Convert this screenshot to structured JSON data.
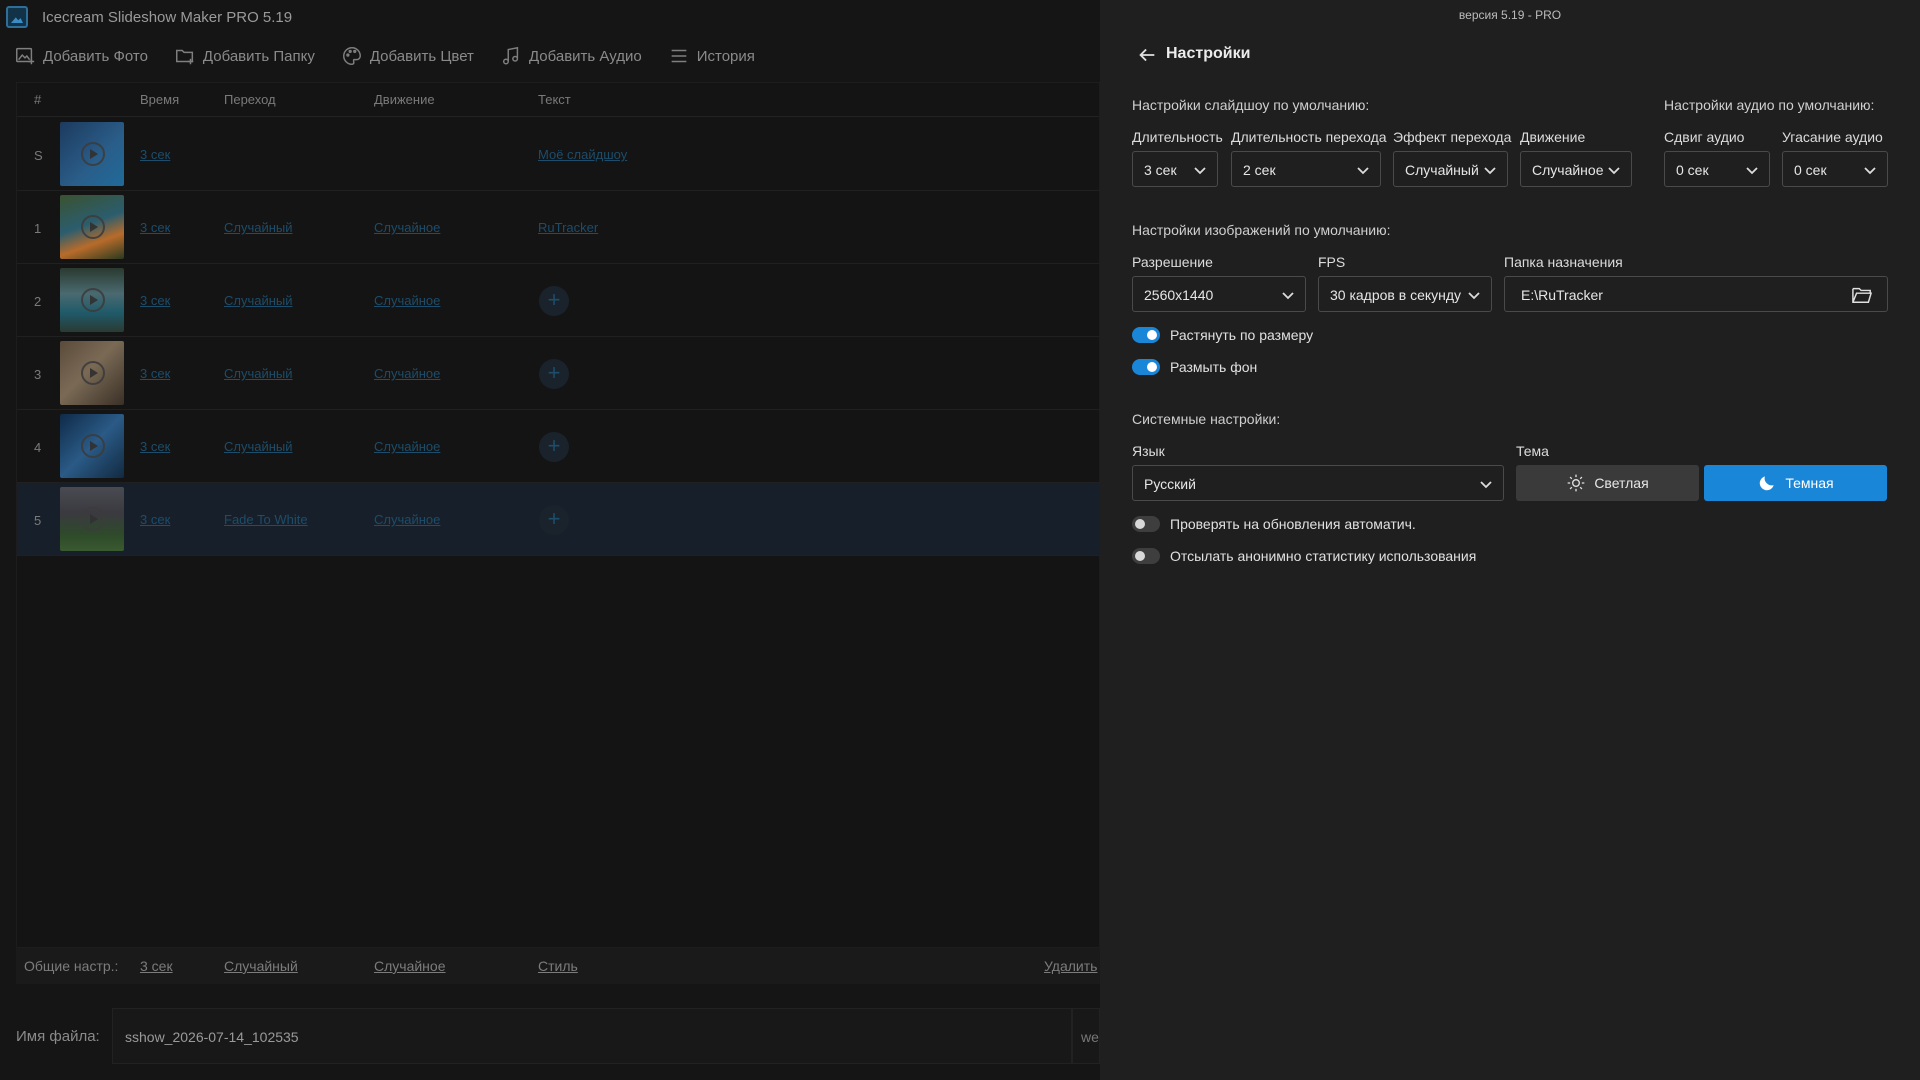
{
  "app": {
    "title": "Icecream Slideshow Maker PRO 5.19"
  },
  "toolbar": {
    "add_photo": "Добавить Фото",
    "add_folder": "Добавить Папку",
    "add_color": "Добавить Цвет",
    "add_audio": "Добавить Аудио",
    "history": "История"
  },
  "table": {
    "headers": {
      "num": "#",
      "time": "Время",
      "transition": "Переход",
      "motion": "Движение",
      "text": "Текст"
    },
    "rows": [
      {
        "num": "S",
        "time": "3 сек",
        "transition": "",
        "motion": "",
        "text": "Моё слайдшоу"
      },
      {
        "num": "1",
        "time": "3 сек",
        "transition": "Случайный",
        "motion": "Случайное",
        "text": "RuTracker"
      },
      {
        "num": "2",
        "time": "3 сек",
        "transition": "Случайный",
        "motion": "Случайное",
        "text": ""
      },
      {
        "num": "3",
        "time": "3 сек",
        "transition": "Случайный",
        "motion": "Случайное",
        "text": ""
      },
      {
        "num": "4",
        "time": "3 сек",
        "transition": "Случайный",
        "motion": "Случайное",
        "text": ""
      },
      {
        "num": "5",
        "time": "3 сек",
        "transition": "Fade To White",
        "motion": "Случайное",
        "text": ""
      }
    ],
    "add_text_icon": "+"
  },
  "footer": {
    "general_label": "Общие настр.:",
    "time": "3 сек",
    "transition": "Случайный",
    "motion": "Случайное",
    "style": "Стиль",
    "delete": "Удалить"
  },
  "filename": {
    "label": "Имя файла:",
    "value": "sshow_2026-07-14_102535",
    "ext": "we"
  },
  "settings": {
    "version": "версия 5.19 - PRO",
    "title": "Настройки",
    "slideshow_defaults": {
      "heading": "Настройки слайдшоу по умолчанию:",
      "duration_label": "Длительность",
      "duration_value": "3 сек",
      "transition_duration_label": "Длительность перехода",
      "transition_duration_value": "2 сек",
      "transition_effect_label": "Эффект перехода",
      "transition_effect_value": "Случайный",
      "motion_label": "Движение",
      "motion_value": "Случайное"
    },
    "audio_defaults": {
      "heading": "Настройки аудио по умолчанию:",
      "shift_label": "Сдвиг аудио",
      "shift_value": "0 сек",
      "fade_label": "Угасание аудио",
      "fade_value": "0 сек"
    },
    "image_defaults": {
      "heading": "Настройки изображений по умолчанию:",
      "resolution_label": "Разрешение",
      "resolution_value": "2560x1440",
      "fps_label": "FPS",
      "fps_value": "30 кадров в секунду",
      "folder_label": "Папка назначения",
      "folder_value": "E:\\RuTracker",
      "stretch_label": "Растянуть по размеру",
      "stretch_on": true,
      "blur_label": "Размыть фон",
      "blur_on": true
    },
    "system": {
      "heading": "Системные настройки:",
      "language_label": "Язык",
      "language_value": "Русский",
      "theme_label": "Тема",
      "theme_light": "Светлая",
      "theme_dark": "Темная",
      "selected_theme": "dark",
      "auto_update_label": "Проверять на обновления автоматич.",
      "auto_update_on": false,
      "stats_label": "Отсылать анонимно статистику использования",
      "stats_on": false
    }
  },
  "colors": {
    "accent": "#1a86d8",
    "panel_bg": "#1f1f1f",
    "app_bg": "#151515",
    "link_dim": "#1d4d6a"
  }
}
